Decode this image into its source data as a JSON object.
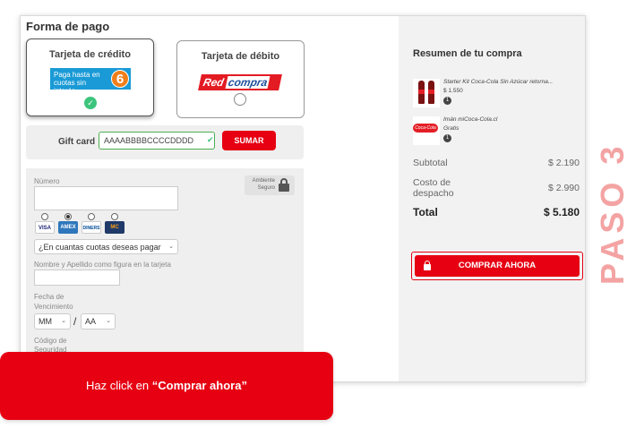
{
  "payment": {
    "title": "Forma de pago",
    "credit_label": "Tarjeta de crédito",
    "cuotas_text": "Paga hasta en cuotas sin interés",
    "cuotas_number": "6",
    "debit_label": "Tarjeta de débito",
    "redcompra_a": "Red",
    "redcompra_b": "compra"
  },
  "gift": {
    "label": "Gift card",
    "value": "AAAABBBBCCCCDDDD",
    "button": "SUMAR"
  },
  "card_form": {
    "numero_label": "Número",
    "ambiente": "Ambiente Seguro",
    "brands": [
      "VISA",
      "AMEX",
      "DINERS",
      "MC"
    ],
    "cuotas_placeholder": "¿En cuantas cuotas deseas pagar",
    "name_label": "Nombre y Apellido como figura en la tarjeta",
    "vencimiento_label": "Fecha de Vencimiento",
    "month": "MM",
    "slash": "/",
    "year": "AA",
    "codigo_label": "Código de Seguridad"
  },
  "summary": {
    "title": "Resumen de tu compra",
    "products": [
      {
        "name": "Starter Kit Coca-Cola Sin Azúcar retorna...",
        "price": "$ 1.550",
        "qty": "1"
      },
      {
        "name": "Imán miCoca-Cola.cl",
        "price": "Gratis",
        "qty": "1"
      }
    ],
    "magnet_text": "Coca-Cola",
    "subtotal_label": "Subtotal",
    "subtotal_value": "$ 2.190",
    "shipping_label": "Costo de despacho",
    "shipping_value": "$ 2.990",
    "total_label": "Total",
    "total_value": "$ 5.180",
    "buy_button": "COMPRAR AHORA"
  },
  "step": "PASO 3",
  "callout": {
    "prefix": "Haz click en ",
    "emphasis": "“Comprar ahora”"
  },
  "colors": {
    "brand_red": "#e60012",
    "step_pink": "#f4a3a3",
    "cuotas_blue": "#1a9ad6",
    "check_green": "#3cc47c"
  }
}
